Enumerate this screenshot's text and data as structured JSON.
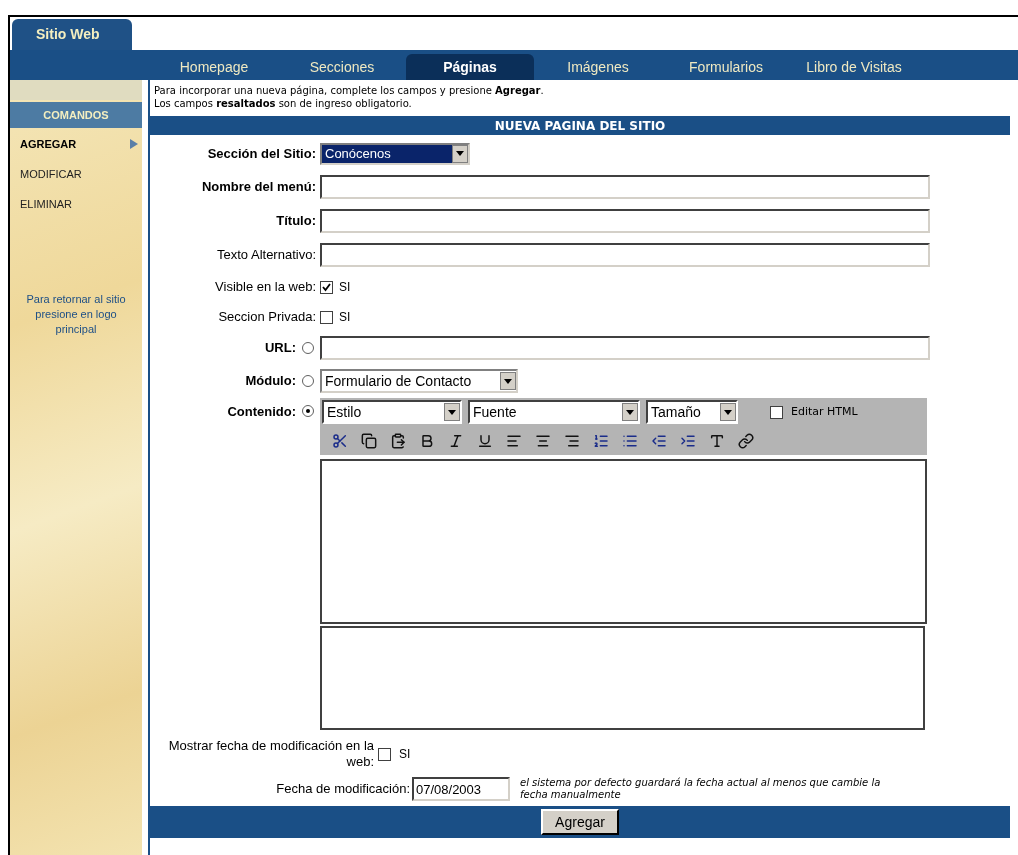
{
  "brand_tab": "Sitio Web",
  "nav": [
    {
      "label": "Homepage",
      "selected": false
    },
    {
      "label": "Secciones",
      "selected": false
    },
    {
      "label": "Páginas",
      "selected": true
    },
    {
      "label": "Imágenes",
      "selected": false
    },
    {
      "label": "Formularios",
      "selected": false
    },
    {
      "label": "Libro de Visitas",
      "selected": false
    }
  ],
  "sidebar": {
    "heading": "COMANDOS",
    "items": [
      {
        "label": "AGREGAR",
        "selected": true
      },
      {
        "label": "MODIFICAR",
        "selected": false
      },
      {
        "label": "ELIMINAR",
        "selected": false
      }
    ],
    "note": "Para retornar al sitio presione en logo principal"
  },
  "intro": [
    "Para incorporar una nueva página, complete los campos y presione **Agregar**.",
    "Los campos **resaltados** son de ingreso obligatorio."
  ],
  "form_title": "NUEVA PAGINA DEL SITIO",
  "fields": [
    {
      "kind": "select",
      "label": "Sección del Sitio:",
      "required": true,
      "value": "Conócenos"
    },
    {
      "kind": "text",
      "label": "Nombre del menú:",
      "required": true
    },
    {
      "kind": "text",
      "label": "Título:",
      "required": true
    },
    {
      "kind": "text",
      "label": "Texto Alternativo:",
      "required": false
    },
    {
      "kind": "checkbox",
      "label": "Visible en la web:",
      "required": false,
      "checked": true,
      "option": "SI"
    },
    {
      "kind": "checkbox",
      "label": "Seccion Privada:",
      "required": false,
      "checked": false,
      "option": "SI"
    },
    {
      "kind": "radio_text",
      "label": "URL:",
      "required": true,
      "selected": false
    },
    {
      "kind": "radio_select",
      "label": "Módulo:",
      "required": true,
      "selected": false,
      "value": "Formulario de Contacto"
    },
    {
      "kind": "radio_editor",
      "label": "Contenido:",
      "required": true,
      "selected": true
    }
  ],
  "editor": {
    "dropdowns": [
      "Estilo",
      "Fuente",
      "Tamaño"
    ],
    "html_toggle": {
      "label": "Editar HTML",
      "checked": false
    }
  },
  "show_date": {
    "label": "Mostrar fecha de modificación en la web:",
    "checked": false,
    "option": "SI"
  },
  "date": {
    "label": "Fecha de modificación:",
    "value": "07/08/2003",
    "hint": "el sistema por defecto guardará la fecha actual al menos que cambie la fecha manualmente"
  },
  "submit": "Agregar"
}
